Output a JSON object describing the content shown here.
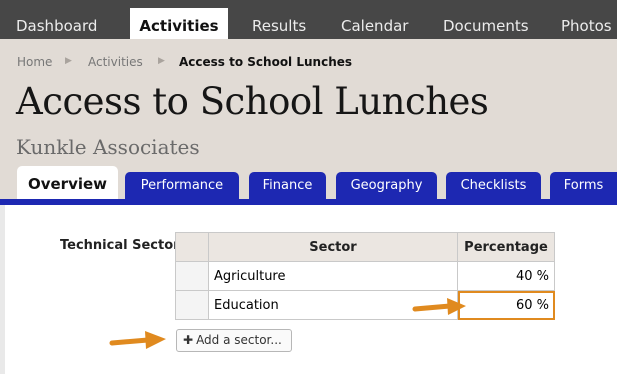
{
  "top_nav": {
    "tabs": [
      "Dashboard",
      "Activities",
      "Results",
      "Calendar",
      "Documents",
      "Photos"
    ],
    "active": 1
  },
  "breadcrumb": {
    "home": "Home",
    "section": "Activities",
    "current": "Access to School Lunches"
  },
  "page": {
    "title": "Access to School Lunches",
    "subtitle": "Kunkle Associates"
  },
  "sub_tabs": {
    "tabs": [
      "Overview",
      "Performance",
      "Finance",
      "Geography",
      "Checklists",
      "Forms"
    ],
    "active": 0
  },
  "sector_field": {
    "label": "Technical Sector",
    "columns": [
      "Sector",
      "Percentage"
    ],
    "rows": [
      {
        "sector": "Agriculture",
        "percentage": "40 %"
      },
      {
        "sector": "Education",
        "percentage": "60 %"
      }
    ],
    "add_label": "Add a sector..."
  },
  "colors": {
    "nav_bg": "#474747",
    "header_bg": "#e1dbd5",
    "tab_blue": "#1d28b2",
    "highlight": "#e08a1f"
  }
}
